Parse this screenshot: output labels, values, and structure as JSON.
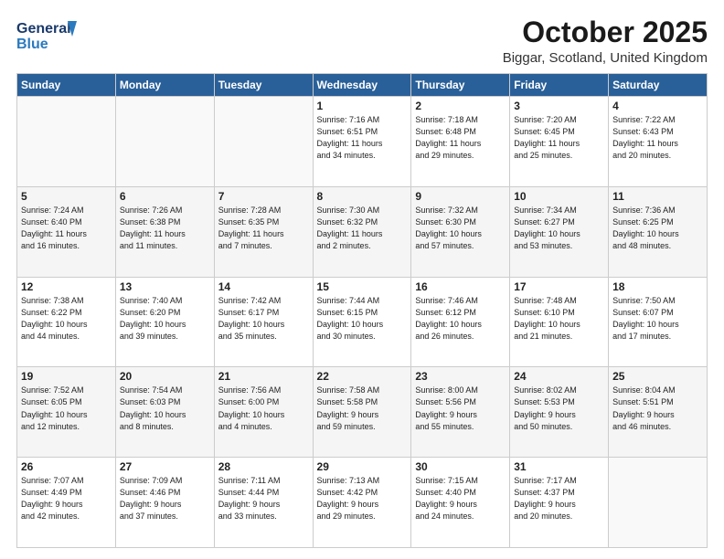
{
  "header": {
    "logo_line1": "General",
    "logo_line2": "Blue",
    "month": "October 2025",
    "location": "Biggar, Scotland, United Kingdom"
  },
  "days_of_week": [
    "Sunday",
    "Monday",
    "Tuesday",
    "Wednesday",
    "Thursday",
    "Friday",
    "Saturday"
  ],
  "weeks": [
    [
      {
        "day": "",
        "info": ""
      },
      {
        "day": "",
        "info": ""
      },
      {
        "day": "",
        "info": ""
      },
      {
        "day": "1",
        "info": "Sunrise: 7:16 AM\nSunset: 6:51 PM\nDaylight: 11 hours\nand 34 minutes."
      },
      {
        "day": "2",
        "info": "Sunrise: 7:18 AM\nSunset: 6:48 PM\nDaylight: 11 hours\nand 29 minutes."
      },
      {
        "day": "3",
        "info": "Sunrise: 7:20 AM\nSunset: 6:45 PM\nDaylight: 11 hours\nand 25 minutes."
      },
      {
        "day": "4",
        "info": "Sunrise: 7:22 AM\nSunset: 6:43 PM\nDaylight: 11 hours\nand 20 minutes."
      }
    ],
    [
      {
        "day": "5",
        "info": "Sunrise: 7:24 AM\nSunset: 6:40 PM\nDaylight: 11 hours\nand 16 minutes."
      },
      {
        "day": "6",
        "info": "Sunrise: 7:26 AM\nSunset: 6:38 PM\nDaylight: 11 hours\nand 11 minutes."
      },
      {
        "day": "7",
        "info": "Sunrise: 7:28 AM\nSunset: 6:35 PM\nDaylight: 11 hours\nand 7 minutes."
      },
      {
        "day": "8",
        "info": "Sunrise: 7:30 AM\nSunset: 6:32 PM\nDaylight: 11 hours\nand 2 minutes."
      },
      {
        "day": "9",
        "info": "Sunrise: 7:32 AM\nSunset: 6:30 PM\nDaylight: 10 hours\nand 57 minutes."
      },
      {
        "day": "10",
        "info": "Sunrise: 7:34 AM\nSunset: 6:27 PM\nDaylight: 10 hours\nand 53 minutes."
      },
      {
        "day": "11",
        "info": "Sunrise: 7:36 AM\nSunset: 6:25 PM\nDaylight: 10 hours\nand 48 minutes."
      }
    ],
    [
      {
        "day": "12",
        "info": "Sunrise: 7:38 AM\nSunset: 6:22 PM\nDaylight: 10 hours\nand 44 minutes."
      },
      {
        "day": "13",
        "info": "Sunrise: 7:40 AM\nSunset: 6:20 PM\nDaylight: 10 hours\nand 39 minutes."
      },
      {
        "day": "14",
        "info": "Sunrise: 7:42 AM\nSunset: 6:17 PM\nDaylight: 10 hours\nand 35 minutes."
      },
      {
        "day": "15",
        "info": "Sunrise: 7:44 AM\nSunset: 6:15 PM\nDaylight: 10 hours\nand 30 minutes."
      },
      {
        "day": "16",
        "info": "Sunrise: 7:46 AM\nSunset: 6:12 PM\nDaylight: 10 hours\nand 26 minutes."
      },
      {
        "day": "17",
        "info": "Sunrise: 7:48 AM\nSunset: 6:10 PM\nDaylight: 10 hours\nand 21 minutes."
      },
      {
        "day": "18",
        "info": "Sunrise: 7:50 AM\nSunset: 6:07 PM\nDaylight: 10 hours\nand 17 minutes."
      }
    ],
    [
      {
        "day": "19",
        "info": "Sunrise: 7:52 AM\nSunset: 6:05 PM\nDaylight: 10 hours\nand 12 minutes."
      },
      {
        "day": "20",
        "info": "Sunrise: 7:54 AM\nSunset: 6:03 PM\nDaylight: 10 hours\nand 8 minutes."
      },
      {
        "day": "21",
        "info": "Sunrise: 7:56 AM\nSunset: 6:00 PM\nDaylight: 10 hours\nand 4 minutes."
      },
      {
        "day": "22",
        "info": "Sunrise: 7:58 AM\nSunset: 5:58 PM\nDaylight: 9 hours\nand 59 minutes."
      },
      {
        "day": "23",
        "info": "Sunrise: 8:00 AM\nSunset: 5:56 PM\nDaylight: 9 hours\nand 55 minutes."
      },
      {
        "day": "24",
        "info": "Sunrise: 8:02 AM\nSunset: 5:53 PM\nDaylight: 9 hours\nand 50 minutes."
      },
      {
        "day": "25",
        "info": "Sunrise: 8:04 AM\nSunset: 5:51 PM\nDaylight: 9 hours\nand 46 minutes."
      }
    ],
    [
      {
        "day": "26",
        "info": "Sunrise: 7:07 AM\nSunset: 4:49 PM\nDaylight: 9 hours\nand 42 minutes."
      },
      {
        "day": "27",
        "info": "Sunrise: 7:09 AM\nSunset: 4:46 PM\nDaylight: 9 hours\nand 37 minutes."
      },
      {
        "day": "28",
        "info": "Sunrise: 7:11 AM\nSunset: 4:44 PM\nDaylight: 9 hours\nand 33 minutes."
      },
      {
        "day": "29",
        "info": "Sunrise: 7:13 AM\nSunset: 4:42 PM\nDaylight: 9 hours\nand 29 minutes."
      },
      {
        "day": "30",
        "info": "Sunrise: 7:15 AM\nSunset: 4:40 PM\nDaylight: 9 hours\nand 24 minutes."
      },
      {
        "day": "31",
        "info": "Sunrise: 7:17 AM\nSunset: 4:37 PM\nDaylight: 9 hours\nand 20 minutes."
      },
      {
        "day": "",
        "info": ""
      }
    ]
  ]
}
